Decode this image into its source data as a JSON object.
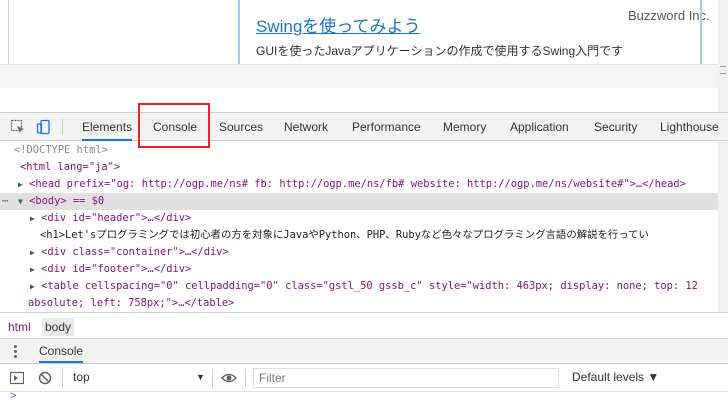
{
  "webpage": {
    "card_link": "Swingを使ってみよう",
    "card_desc": "GUIを使ったJavaアプリケーションの作成で使用するSwing入門です",
    "site_name": "Buzzword Inc."
  },
  "devtools": {
    "tabs": [
      "Elements",
      "Console",
      "Sources",
      "Network",
      "Performance",
      "Memory",
      "Application",
      "Security",
      "Lighthouse"
    ],
    "active_tab": "Elements",
    "dom": {
      "doctype": "<!DOCTYPE html>",
      "html_open": "<html lang=\"ja\">",
      "head": "<head prefix=\"og: http://ogp.me/ns# fb: http://ogp.me/ns/fb# website: http://ogp.me/ns/website#\">…</head>",
      "body": "<body> == $0",
      "header": "<div id=\"header\">…</div>",
      "h1": "<h1>Let'sプログラミングでは初心者の方を対象にJavaやPython、PHP、Rubyなど色々なプログラミング言語の解説を行ってい",
      "container": "<div class=\"container\">…</div>",
      "footer": "<div id=\"footer\">…</div>",
      "table_1": "<table cellspacing=\"0\" cellpadding=\"0\" class=\"gstl_50 gssb_c\" style=\"width: 463px; display: none; top: 12",
      "table_2": "absolute; left: 758px;\">…</table>"
    },
    "breadcrumbs": [
      "html",
      "body"
    ],
    "drawer_tab": "Console",
    "console_toolbar": {
      "context": "top",
      "filter_placeholder": "Filter",
      "levels": "Default levels ▼"
    },
    "prompt": ">"
  }
}
